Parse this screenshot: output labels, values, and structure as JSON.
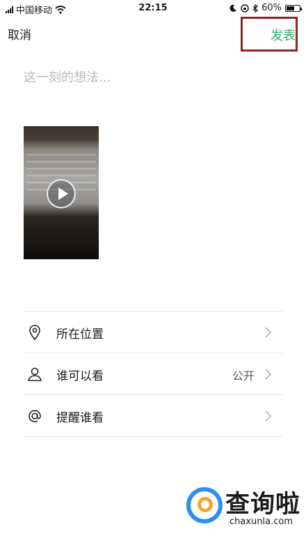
{
  "status_bar": {
    "carrier": "中国移动",
    "time": "22:15",
    "battery_percent": "60%",
    "battery_level": 0.6
  },
  "nav": {
    "cancel_label": "取消",
    "publish_label": "发表",
    "publish_color": "#2aae67"
  },
  "compose": {
    "placeholder": "这一刻的想法..."
  },
  "media": {
    "type": "video",
    "play_icon": "play-icon"
  },
  "options": [
    {
      "icon": "location-pin-icon",
      "label": "所在位置",
      "value": ""
    },
    {
      "icon": "person-icon",
      "label": "谁可以看",
      "value": "公开"
    },
    {
      "icon": "at-sign-icon",
      "label": "提醒谁看",
      "value": ""
    }
  ],
  "watermark": {
    "name": "查询啦",
    "url": "chaxunla.com"
  }
}
